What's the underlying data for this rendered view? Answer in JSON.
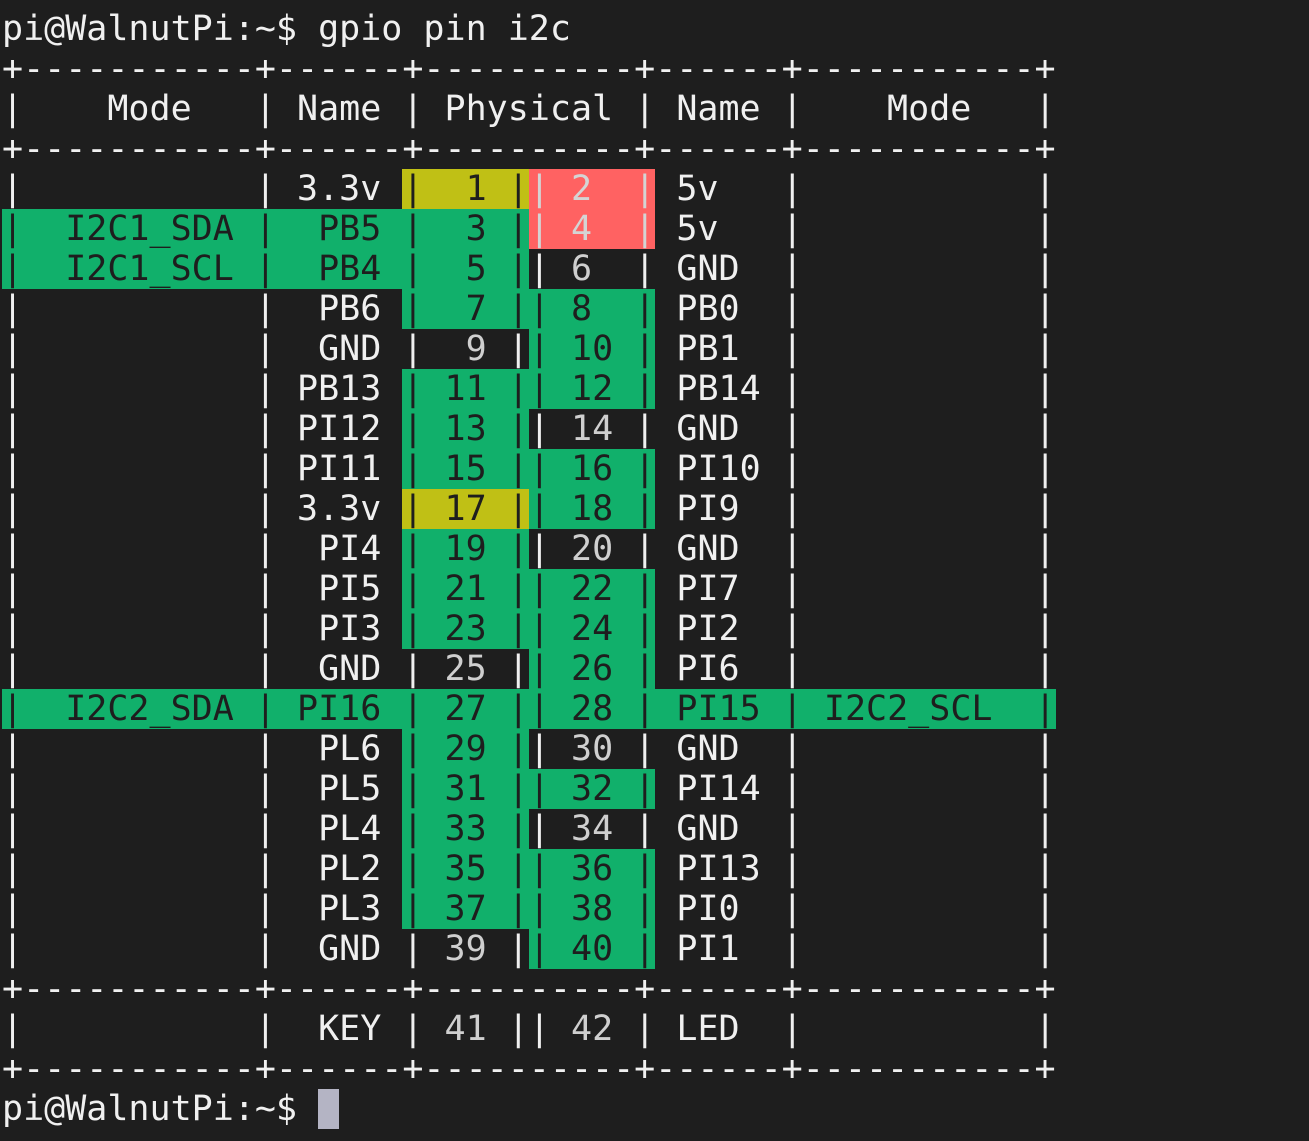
{
  "terminal": {
    "prompt": "pi@WalnutPi:~$ ",
    "command": "gpio pin i2c",
    "final_prompt": "pi@WalnutPi:~$ ",
    "cursor": "block-cursor"
  },
  "table": {
    "border_widths": [
      11,
      6,
      10,
      6,
      11
    ],
    "headers": {
      "left_mode": "Mode",
      "left_name": "Name",
      "physical": "Physical",
      "right_name": "Name",
      "right_mode": "Mode"
    },
    "colors": {
      "background": "#1e1e1e",
      "gpio_green": "#11b06b",
      "power_3v3_yellow": "#c0c015",
      "power_5v_red": "#ff6262",
      "text": "#f0f0f0",
      "cursor": "#b4b4c4"
    },
    "rows": [
      {
        "left_mode": "",
        "left_name": "3.3v",
        "left_pin": "1",
        "left_type": "3v3",
        "right_pin": "2",
        "right_type": "5v",
        "right_name": "5v",
        "right_mode": ""
      },
      {
        "left_mode": "I2C1_SDA",
        "left_name": "PB5",
        "left_pin": "3",
        "left_type": "gpio",
        "right_pin": "4",
        "right_type": "5v",
        "right_name": "5v",
        "right_mode": ""
      },
      {
        "left_mode": "I2C1_SCL",
        "left_name": "PB4",
        "left_pin": "5",
        "left_type": "gpio",
        "right_pin": "6",
        "right_type": "gnd",
        "right_name": "GND",
        "right_mode": ""
      },
      {
        "left_mode": "",
        "left_name": "PB6",
        "left_pin": "7",
        "left_type": "gpio",
        "right_pin": "8",
        "right_type": "gpio",
        "right_name": "PB0",
        "right_mode": ""
      },
      {
        "left_mode": "",
        "left_name": "GND",
        "left_pin": "9",
        "left_type": "gnd",
        "right_pin": "10",
        "right_type": "gpio",
        "right_name": "PB1",
        "right_mode": ""
      },
      {
        "left_mode": "",
        "left_name": "PB13",
        "left_pin": "11",
        "left_type": "gpio",
        "right_pin": "12",
        "right_type": "gpio",
        "right_name": "PB14",
        "right_mode": ""
      },
      {
        "left_mode": "",
        "left_name": "PI12",
        "left_pin": "13",
        "left_type": "gpio",
        "right_pin": "14",
        "right_type": "gnd",
        "right_name": "GND",
        "right_mode": ""
      },
      {
        "left_mode": "",
        "left_name": "PI11",
        "left_pin": "15",
        "left_type": "gpio",
        "right_pin": "16",
        "right_type": "gpio",
        "right_name": "PI10",
        "right_mode": ""
      },
      {
        "left_mode": "",
        "left_name": "3.3v",
        "left_pin": "17",
        "left_type": "3v3",
        "right_pin": "18",
        "right_type": "gpio",
        "right_name": "PI9",
        "right_mode": ""
      },
      {
        "left_mode": "",
        "left_name": "PI4",
        "left_pin": "19",
        "left_type": "gpio",
        "right_pin": "20",
        "right_type": "gnd",
        "right_name": "GND",
        "right_mode": ""
      },
      {
        "left_mode": "",
        "left_name": "PI5",
        "left_pin": "21",
        "left_type": "gpio",
        "right_pin": "22",
        "right_type": "gpio",
        "right_name": "PI7",
        "right_mode": ""
      },
      {
        "left_mode": "",
        "left_name": "PI3",
        "left_pin": "23",
        "left_type": "gpio",
        "right_pin": "24",
        "right_type": "gpio",
        "right_name": "PI2",
        "right_mode": ""
      },
      {
        "left_mode": "",
        "left_name": "GND",
        "left_pin": "25",
        "left_type": "gnd",
        "right_pin": "26",
        "right_type": "gpio",
        "right_name": "PI6",
        "right_mode": ""
      },
      {
        "left_mode": "I2C2_SDA",
        "left_name": "PI16",
        "left_pin": "27",
        "left_type": "gpio",
        "right_pin": "28",
        "right_type": "gpio",
        "right_name": "PI15",
        "right_mode": "I2C2_SCL"
      },
      {
        "left_mode": "",
        "left_name": "PL6",
        "left_pin": "29",
        "left_type": "gpio",
        "right_pin": "30",
        "right_type": "gnd",
        "right_name": "GND",
        "right_mode": ""
      },
      {
        "left_mode": "",
        "left_name": "PL5",
        "left_pin": "31",
        "left_type": "gpio",
        "right_pin": "32",
        "right_type": "gpio",
        "right_name": "PI14",
        "right_mode": ""
      },
      {
        "left_mode": "",
        "left_name": "PL4",
        "left_pin": "33",
        "left_type": "gpio",
        "right_pin": "34",
        "right_type": "gnd",
        "right_name": "GND",
        "right_mode": ""
      },
      {
        "left_mode": "",
        "left_name": "PL2",
        "left_pin": "35",
        "left_type": "gpio",
        "right_pin": "36",
        "right_type": "gpio",
        "right_name": "PI13",
        "right_mode": ""
      },
      {
        "left_mode": "",
        "left_name": "PL3",
        "left_pin": "37",
        "left_type": "gpio",
        "right_pin": "38",
        "right_type": "gpio",
        "right_name": "PI0",
        "right_mode": ""
      },
      {
        "left_mode": "",
        "left_name": "GND",
        "left_pin": "39",
        "left_type": "gnd",
        "right_pin": "40",
        "right_type": "gpio",
        "right_name": "PI1",
        "right_mode": ""
      }
    ],
    "extra_rows": [
      {
        "left_mode": "",
        "left_name": "KEY",
        "left_pin": "41",
        "left_type": "other",
        "right_pin": "42",
        "right_type": "other",
        "right_name": "LED",
        "right_mode": ""
      }
    ]
  }
}
